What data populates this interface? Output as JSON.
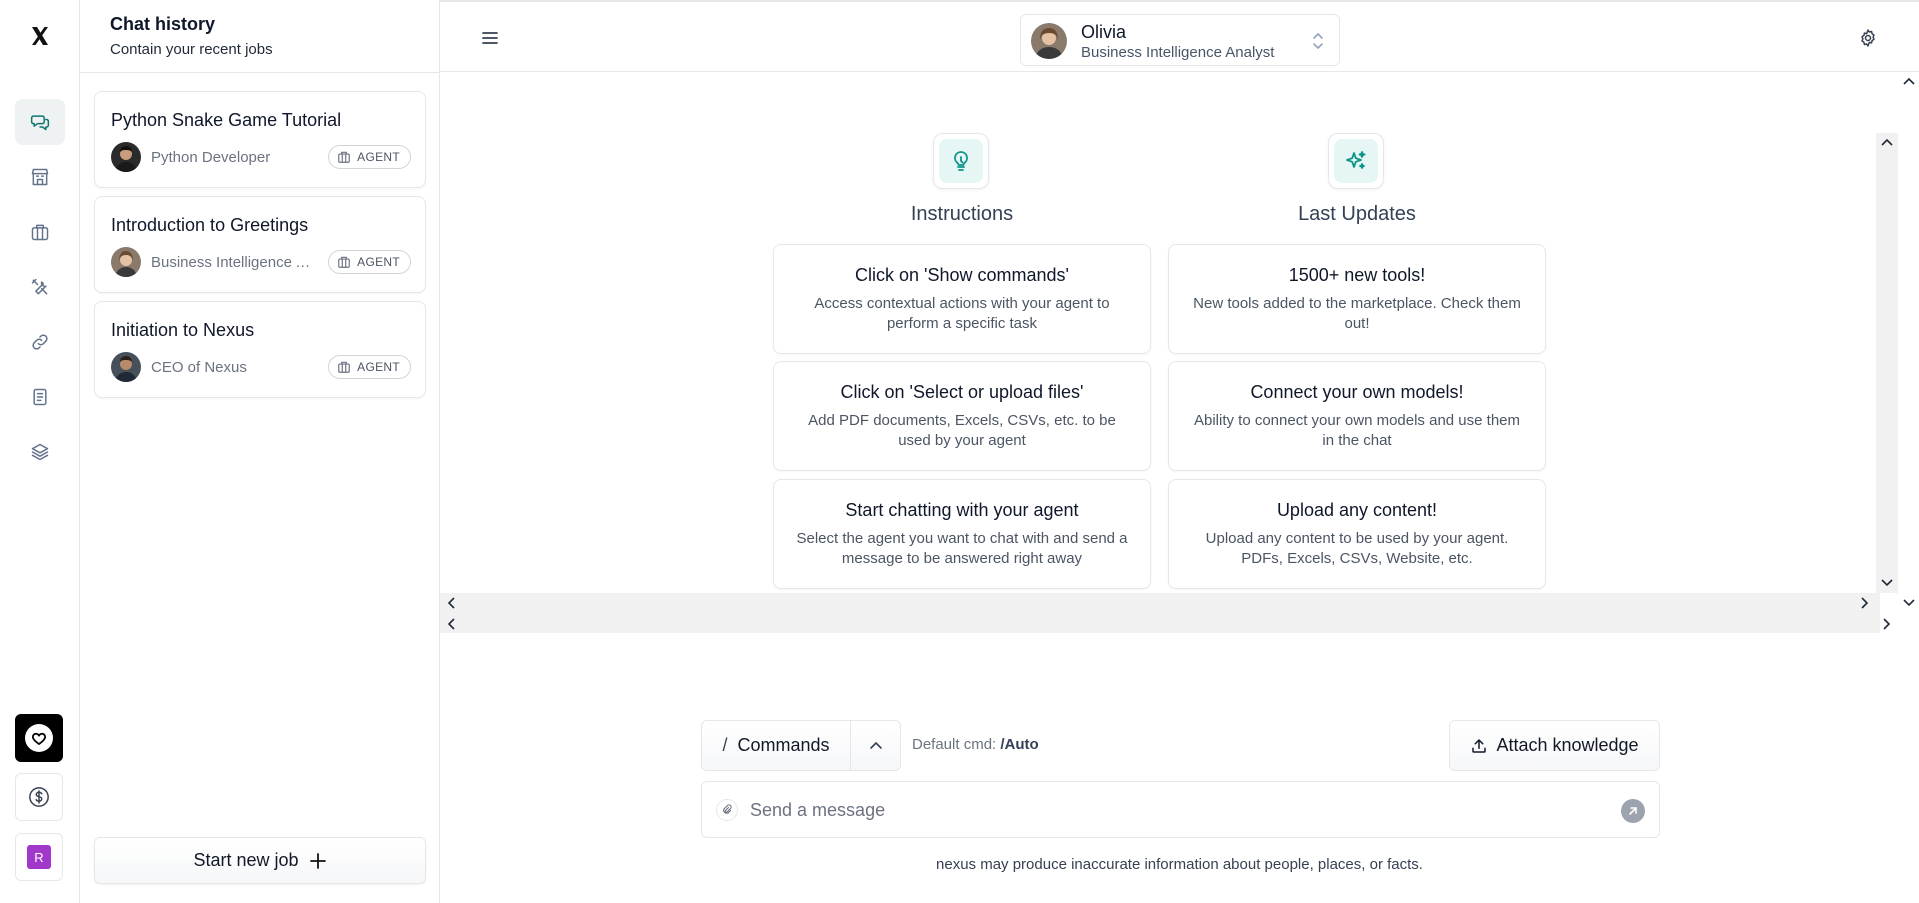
{
  "app": {
    "logo": "X"
  },
  "rail": {
    "items": [
      {
        "name": "chat-icon",
        "active": true
      },
      {
        "name": "store-icon",
        "active": false
      },
      {
        "name": "briefcase-icon",
        "active": false
      },
      {
        "name": "tools-icon",
        "active": false
      },
      {
        "name": "link-icon",
        "active": false
      },
      {
        "name": "document-icon",
        "active": false
      },
      {
        "name": "layers-icon",
        "active": false
      }
    ],
    "avatar_letter": "R"
  },
  "history": {
    "title": "Chat history",
    "subtitle": "Contain your recent jobs",
    "jobs": [
      {
        "title": "Python Snake Game Tutorial",
        "role": "Python Developer",
        "badge": "AGENT"
      },
      {
        "title": "Introduction to Greetings",
        "role": "Business Intelligence Analyst",
        "badge": "AGENT"
      },
      {
        "title": "Initiation to Nexus",
        "role": "CEO of Nexus",
        "badge": "AGENT"
      }
    ],
    "start_new_label": "Start new job"
  },
  "topbar": {
    "user_name": "Olivia",
    "user_role": "Business Intelligence Analyst"
  },
  "sections": {
    "instructions": {
      "title": "Instructions",
      "cards": [
        {
          "title": "Click on 'Show commands'",
          "desc": "Access contextual actions with your agent to perform a specific task"
        },
        {
          "title": "Click on 'Select or upload files'",
          "desc": "Add PDF documents, Excels, CSVs, etc. to be used by your agent"
        },
        {
          "title": "Start chatting with your agent",
          "desc": "Select the agent you want to chat with and send a message to be answered right away"
        }
      ]
    },
    "updates": {
      "title": "Last Updates",
      "cards": [
        {
          "title": "1500+ new tools!",
          "desc": "New tools added to the marketplace. Check them out!"
        },
        {
          "title": "Connect your own models!",
          "desc": "Ability to connect your own models and use them in the chat"
        },
        {
          "title": "Upload any content!",
          "desc": "Upload any content to be used by your agent. PDFs, Excels, CSVs, Website, etc."
        }
      ]
    }
  },
  "composer": {
    "commands_slash": "/",
    "commands_label": "Commands",
    "default_cmd_label": "Default cmd:",
    "default_cmd_value": "/Auto",
    "attach_label": "Attach knowledge",
    "placeholder": "Send a message",
    "disclaimer": "nexus may produce inaccurate information about people, places, or facts."
  },
  "colors": {
    "accent": "#0d9488",
    "accent_bg": "#e6f6f4",
    "avatar_r": "#a238c9"
  }
}
